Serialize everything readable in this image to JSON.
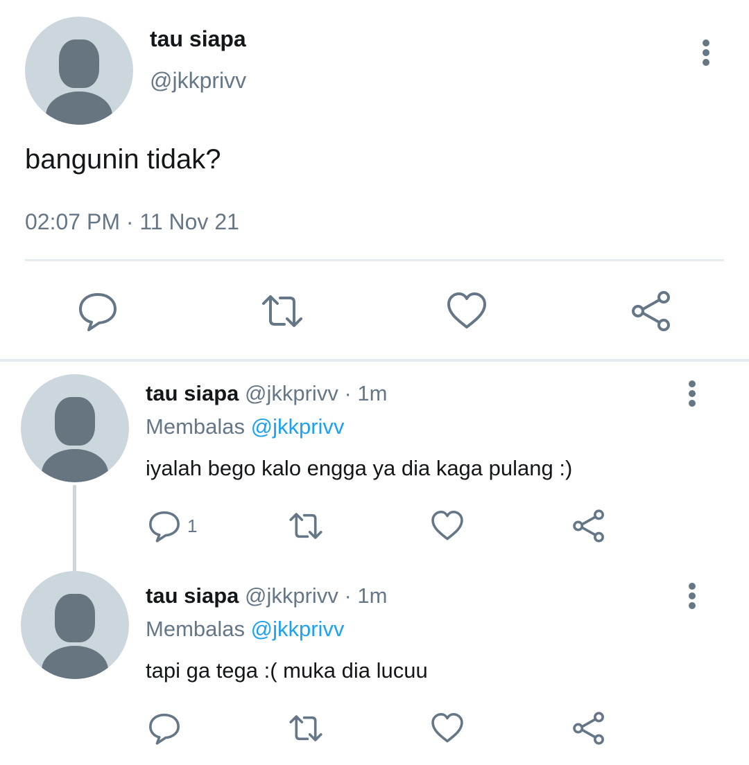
{
  "main_tweet": {
    "author_name": "tau siapa",
    "author_handle": "@jkkprivv",
    "text": "bangunin tidak?",
    "meta": "02:07 PM · 11 Nov 21"
  },
  "replies": [
    {
      "author_name": "tau siapa",
      "author_handle": "@jkkprivv",
      "time": "· 1m",
      "replying_prefix": "Membalas",
      "replying_to": "@jkkprivv",
      "text": "iyalah bego kalo engga ya dia kaga pulang :)",
      "reply_count": "1"
    },
    {
      "author_name": "tau siapa",
      "author_handle": "@jkkprivv",
      "time": "· 1m",
      "replying_prefix": "Membalas",
      "replying_to": "@jkkprivv",
      "text": "tapi ga tega :( muka dia lucuu",
      "reply_count": ""
    }
  ],
  "icons": {
    "reply": "speech-bubble-icon",
    "retweet": "retweet-icon",
    "like": "heart-icon",
    "share": "share-icon",
    "more": "more-vertical-icon"
  },
  "colors": {
    "text": "#14171a",
    "secondary": "#657786",
    "accent": "#1da1f2",
    "avatar_bg": "#ccd6dd",
    "avatar_fg": "#66757f",
    "divider": "#e6ecf0"
  }
}
